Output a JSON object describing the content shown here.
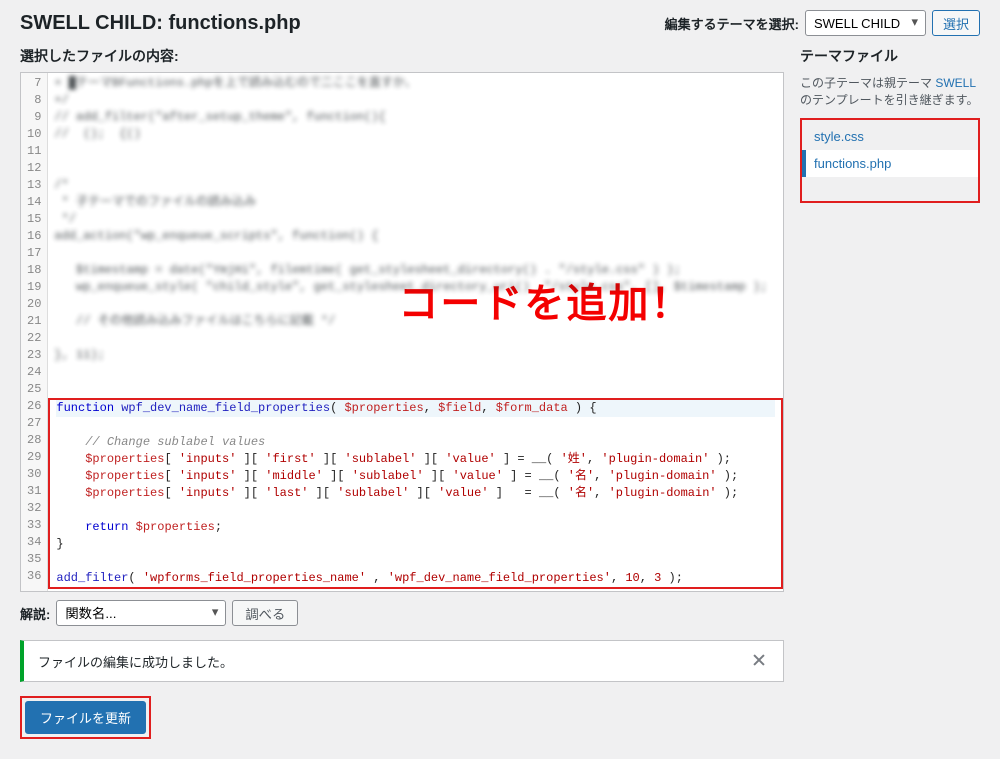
{
  "header": {
    "title": "SWELL CHILD: functions.php",
    "theme_select_label": "編集するテーマを選択:",
    "theme_select_value": "SWELL CHILD",
    "select_button": "選択"
  },
  "selected_file_label": "選択したファイルの内容:",
  "sidebar": {
    "heading": "テーマファイル",
    "desc_prefix": "この子テーマは親テーマ ",
    "desc_link": "SWELL",
    "desc_suffix": " のテンプレートを引き継ぎます。",
    "files": [
      {
        "name": "style.css",
        "active": false
      },
      {
        "name": "functions.php",
        "active": true
      }
    ]
  },
  "annotation": "コードを追加！",
  "blurred_lines": {
    "7": "+ █テーマBFunctions.phpを上で読み込むので二ここを直すか、",
    "8": "+/",
    "9": "// add_filter(\"after_setup_theme\", function(){",
    "10": "//  ();  {()",
    "11": "",
    "12": "",
    "13": "/*",
    "14": " * 子テーマでのファイルの読み込み",
    "15": " */",
    "16": "add_action(\"wp_enqueue_scripts\", function() {",
    "17": "",
    "18": "   $timestamp = date(\"YmjHi\", filemtime( get_stylesheet_directory() . \"/style.css\" ) );",
    "19": "   wp_enqueue_style( \"child_style\", get_stylesheet_directory_uri() .\"/style.css\", [], $timestamp );",
    "20": "",
    "21": "   // その他読み込みファイルはこちらに記載 */",
    "22": "",
    "23": "}, 11);",
    "24": ""
  },
  "code_lines": [
    {
      "n": 26,
      "hl": true,
      "tokens": [
        {
          "t": "function ",
          "c": "tok-kw"
        },
        {
          "t": "wpf_dev_name_field_properties",
          "c": "tok-fn"
        },
        {
          "t": "( ",
          "c": "tok-op"
        },
        {
          "t": "$properties",
          "c": "tok-var"
        },
        {
          "t": ", ",
          "c": "tok-op"
        },
        {
          "t": "$field",
          "c": "tok-var"
        },
        {
          "t": ", ",
          "c": "tok-op"
        },
        {
          "t": "$form_data",
          "c": "tok-var"
        },
        {
          "t": " ) {",
          "c": "tok-op"
        }
      ]
    },
    {
      "n": 27,
      "tokens": []
    },
    {
      "n": 28,
      "tokens": [
        {
          "t": "    ",
          "c": ""
        },
        {
          "t": "// Change sublabel values",
          "c": "tok-com"
        }
      ]
    },
    {
      "n": 29,
      "tokens": [
        {
          "t": "    ",
          "c": ""
        },
        {
          "t": "$properties",
          "c": "tok-var"
        },
        {
          "t": "[ ",
          "c": "tok-op"
        },
        {
          "t": "'inputs'",
          "c": "tok-str"
        },
        {
          "t": " ][ ",
          "c": "tok-op"
        },
        {
          "t": "'first'",
          "c": "tok-str"
        },
        {
          "t": " ][ ",
          "c": "tok-op"
        },
        {
          "t": "'sublabel'",
          "c": "tok-str"
        },
        {
          "t": " ][ ",
          "c": "tok-op"
        },
        {
          "t": "'value'",
          "c": "tok-str"
        },
        {
          "t": " ] = __( ",
          "c": "tok-op"
        },
        {
          "t": "'姓'",
          "c": "tok-str"
        },
        {
          "t": ", ",
          "c": "tok-op"
        },
        {
          "t": "'plugin-domain'",
          "c": "tok-str"
        },
        {
          "t": " );",
          "c": "tok-op"
        }
      ]
    },
    {
      "n": 30,
      "tokens": [
        {
          "t": "    ",
          "c": ""
        },
        {
          "t": "$properties",
          "c": "tok-var"
        },
        {
          "t": "[ ",
          "c": "tok-op"
        },
        {
          "t": "'inputs'",
          "c": "tok-str"
        },
        {
          "t": " ][ ",
          "c": "tok-op"
        },
        {
          "t": "'middle'",
          "c": "tok-str"
        },
        {
          "t": " ][ ",
          "c": "tok-op"
        },
        {
          "t": "'sublabel'",
          "c": "tok-str"
        },
        {
          "t": " ][ ",
          "c": "tok-op"
        },
        {
          "t": "'value'",
          "c": "tok-str"
        },
        {
          "t": " ] = __( ",
          "c": "tok-op"
        },
        {
          "t": "'名'",
          "c": "tok-str"
        },
        {
          "t": ", ",
          "c": "tok-op"
        },
        {
          "t": "'plugin-domain'",
          "c": "tok-str"
        },
        {
          "t": " );",
          "c": "tok-op"
        }
      ]
    },
    {
      "n": 31,
      "tokens": [
        {
          "t": "    ",
          "c": ""
        },
        {
          "t": "$properties",
          "c": "tok-var"
        },
        {
          "t": "[ ",
          "c": "tok-op"
        },
        {
          "t": "'inputs'",
          "c": "tok-str"
        },
        {
          "t": " ][ ",
          "c": "tok-op"
        },
        {
          "t": "'last'",
          "c": "tok-str"
        },
        {
          "t": " ][ ",
          "c": "tok-op"
        },
        {
          "t": "'sublabel'",
          "c": "tok-str"
        },
        {
          "t": " ][ ",
          "c": "tok-op"
        },
        {
          "t": "'value'",
          "c": "tok-str"
        },
        {
          "t": " ]   = __( ",
          "c": "tok-op"
        },
        {
          "t": "'名'",
          "c": "tok-str"
        },
        {
          "t": ", ",
          "c": "tok-op"
        },
        {
          "t": "'plugin-domain'",
          "c": "tok-str"
        },
        {
          "t": " );",
          "c": "tok-op"
        }
      ]
    },
    {
      "n": 32,
      "tokens": []
    },
    {
      "n": 33,
      "tokens": [
        {
          "t": "    ",
          "c": ""
        },
        {
          "t": "return ",
          "c": "tok-kw"
        },
        {
          "t": "$properties",
          "c": "tok-var"
        },
        {
          "t": ";",
          "c": "tok-op"
        }
      ]
    },
    {
      "n": 34,
      "tokens": [
        {
          "t": "}",
          "c": "tok-op"
        }
      ]
    },
    {
      "n": 35,
      "tokens": []
    },
    {
      "n": 36,
      "tokens": [
        {
          "t": "add_filter",
          "c": "tok-fn"
        },
        {
          "t": "( ",
          "c": "tok-op"
        },
        {
          "t": "'wpforms_field_properties_name'",
          "c": "tok-str"
        },
        {
          "t": " , ",
          "c": "tok-op"
        },
        {
          "t": "'wpf_dev_name_field_properties'",
          "c": "tok-str"
        },
        {
          "t": ", ",
          "c": "tok-op"
        },
        {
          "t": "10",
          "c": "tok-num"
        },
        {
          "t": ", ",
          "c": "tok-op"
        },
        {
          "t": "3",
          "c": "tok-num"
        },
        {
          "t": " );",
          "c": "tok-op"
        }
      ]
    }
  ],
  "doc": {
    "label": "解説:",
    "select_value": "関数名...",
    "button": "調べる"
  },
  "notice": {
    "text": "ファイルの編集に成功しました。"
  },
  "submit": {
    "label": "ファイルを更新"
  }
}
